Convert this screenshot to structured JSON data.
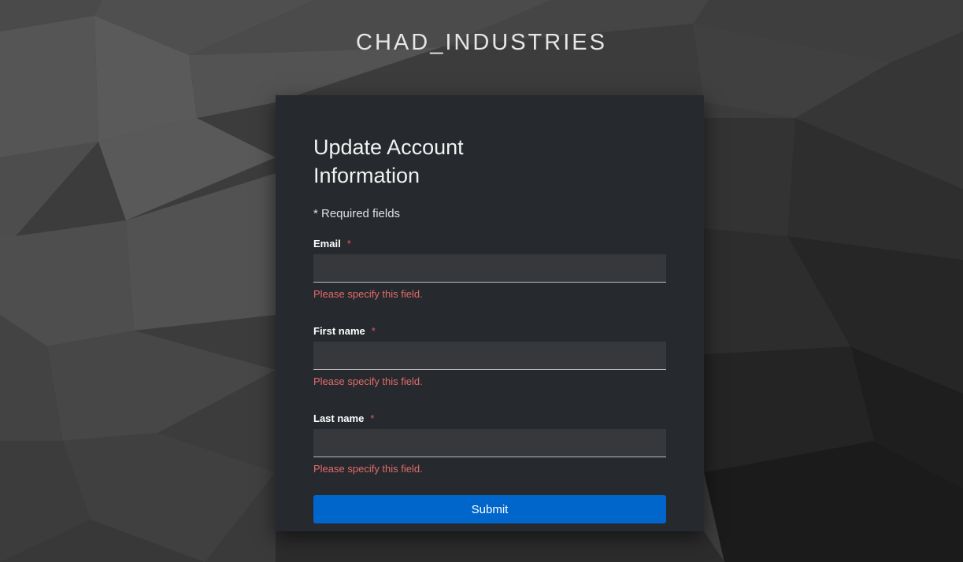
{
  "brand": {
    "name": "CHAD_INDUSTRIES"
  },
  "form": {
    "title": "Update Account Information",
    "required_note": "* Required fields",
    "required_marker": "*",
    "fields": [
      {
        "label": "Email",
        "value": "",
        "error": "Please specify this field."
      },
      {
        "label": "First name",
        "value": "",
        "error": "Please specify this field."
      },
      {
        "label": "Last name",
        "value": "",
        "error": "Please specify this field."
      }
    ],
    "submit_label": "Submit"
  },
  "colors": {
    "accent": "#0066cc",
    "error": "#e26b6b",
    "card_bg": "#26292d"
  }
}
